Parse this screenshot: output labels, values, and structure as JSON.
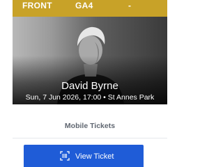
{
  "ticket_bar": {
    "section": "FRONT",
    "area": "GA4",
    "seat": "-"
  },
  "event": {
    "artist": "David Byrne",
    "details": "Sun, 7 Jun 2026, 17:00 • St Annes Park"
  },
  "tickets": {
    "type_label": "Mobile Tickets",
    "view_button_label": "View Ticket",
    "view_button_icon": "barcode-icon"
  },
  "colors": {
    "top_bar": "#c8a228",
    "button": "#1f5cd7"
  }
}
